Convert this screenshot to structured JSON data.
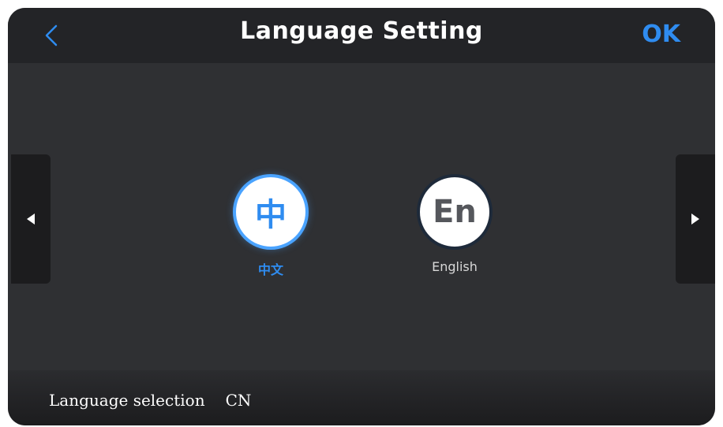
{
  "header": {
    "title": "Language Setting",
    "ok_label": "OK",
    "back_icon": "chevron-left-icon"
  },
  "languages": [
    {
      "glyph": "中",
      "label": "中文",
      "selected": true
    },
    {
      "glyph": "En",
      "label": "English",
      "selected": false
    }
  ],
  "nav": {
    "prev_icon": "triangle-left-icon",
    "next_icon": "triangle-right-icon"
  },
  "status": {
    "label": "Language selection",
    "value": "CN"
  },
  "colors": {
    "accent": "#2f8cf0",
    "background": "#2f3033",
    "header": "#232427"
  }
}
